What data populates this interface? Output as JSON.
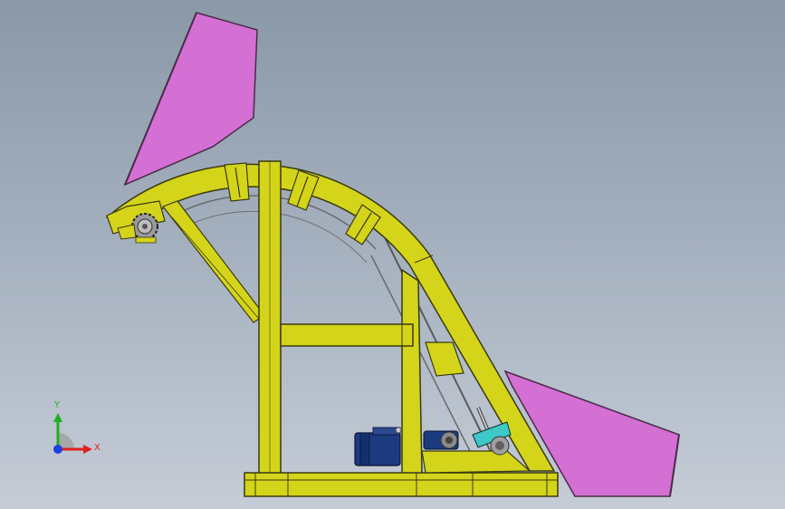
{
  "viewport": {
    "background_top": "#8a98a8",
    "background_bottom": "#c5ccd6"
  },
  "colors": {
    "frame": "#d4d41a",
    "frame_stroke": "#3a3a10",
    "hopper": "#d46fd4",
    "hopper_stroke": "#4a2a4a",
    "motor": "#1c3a80",
    "gearbox": "#3ec8c8"
  },
  "triad": {
    "x_label": "X",
    "y_label": "Y",
    "x_color": "#e02020",
    "y_color": "#20b020",
    "z_color": "#2040e0"
  }
}
